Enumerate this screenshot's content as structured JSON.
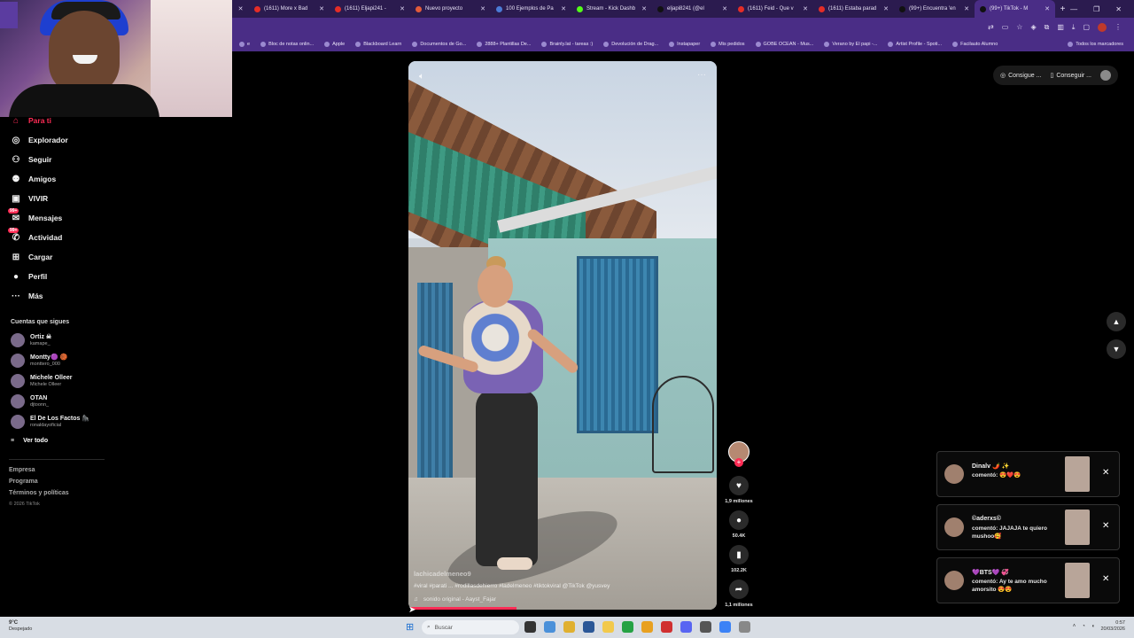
{
  "browser": {
    "tabs": [
      {
        "title": "(1611) More x Bad",
        "color": "#e52d27"
      },
      {
        "title": "(1611) Eljapi241 -",
        "color": "#e52d27"
      },
      {
        "title": "Nuevo proyecto",
        "color": "#e25b3a"
      },
      {
        "title": "100 Ejemplos de Pa",
        "color": "#4b7bd6"
      },
      {
        "title": "Stream - Kick Dashb",
        "color": "#53fc18"
      },
      {
        "title": "eljapi8241 (@el",
        "color": "#111111"
      },
      {
        "title": "(1611) Feid - Que v",
        "color": "#e52d27"
      },
      {
        "title": "(1611) Estaba parad",
        "color": "#e52d27"
      },
      {
        "title": "(99+) Encuentra 'en",
        "color": "#111111"
      },
      {
        "title": "(99+) TikTok - M",
        "color": "#111111"
      }
    ],
    "bookmarks": [
      "e",
      "Bloc de notas onlin...",
      "Apple",
      "Blackboard Learn",
      "Documentos de Go...",
      "2888+ Plantillas De...",
      "Brainly.lat - tareas :)",
      "Devolución de Drag...",
      "Instapaper",
      "Mis pedidos",
      "GOBE OCEAN - Mus...",
      "Verano by El papi -...",
      "Artist Profile - Spoti...",
      "Facilauto Alumno"
    ],
    "all_bookmarks": "Todos los marcadores"
  },
  "sidebar": {
    "nav": [
      {
        "label": "Para ti",
        "icon": "home-icon",
        "glyph": "⌂",
        "active": true,
        "badge": ""
      },
      {
        "label": "Explorador",
        "icon": "compass-icon",
        "glyph": "◎",
        "active": false,
        "badge": ""
      },
      {
        "label": "Seguir",
        "icon": "follow-icon",
        "glyph": "⚇",
        "active": false,
        "badge": ""
      },
      {
        "label": "Amigos",
        "icon": "friends-icon",
        "glyph": "⚉",
        "active": false,
        "badge": ""
      },
      {
        "label": "VIVIR",
        "icon": "live-icon",
        "glyph": "▣",
        "active": false,
        "badge": ""
      },
      {
        "label": "Mensajes",
        "icon": "messages-icon",
        "glyph": "✉",
        "active": false,
        "badge": "99+"
      },
      {
        "label": "Actividad",
        "icon": "activity-icon",
        "glyph": "✆",
        "active": false,
        "badge": "99+"
      },
      {
        "label": "Cargar",
        "icon": "upload-icon",
        "glyph": "⊞",
        "active": false,
        "badge": ""
      },
      {
        "label": "Perfil",
        "icon": "profile-icon",
        "glyph": "●",
        "active": false,
        "badge": ""
      },
      {
        "label": "Más",
        "icon": "more-icon",
        "glyph": "···",
        "active": false,
        "badge": ""
      }
    ],
    "following_title": "Cuentas que sigues",
    "following": [
      {
        "name": "Ortiz ☠",
        "handle": "kamape_"
      },
      {
        "name": "Montty🟣 🏀",
        "handle": "monttero_000"
      },
      {
        "name": "Michele Olleer",
        "handle": "Michele Olleer"
      },
      {
        "name": "OTAN",
        "handle": "djtoonn_"
      },
      {
        "name": "El De Los Factos 🦍",
        "handle": "ronaldayoficial"
      }
    ],
    "see_all": "Ver todo",
    "footer": [
      "Empresa",
      "Programa",
      "Términos y políticas"
    ],
    "copyright": "© 2026 TikTok"
  },
  "video": {
    "username": "lachicadelmeneo9",
    "hashtags": "#viral #parati ... #rodillasdehierro #ladelmeneo #tiktokviral @TikTok @yusvey",
    "sound": "sonido original - Aayst_Fajar",
    "progress": 0.35
  },
  "actions": {
    "likes": "1,9 millones",
    "comments": "50.4K",
    "saves": "102.2K",
    "shares": "1,1 millones"
  },
  "top_buttons": [
    "Consigue ...",
    "Conseguir ..."
  ],
  "notifications": [
    {
      "name": "Dinalv 🌶️ ✨",
      "text": "comentó: 😍❤️😍"
    },
    {
      "name": "©aderxs©",
      "text": "comentó: JAJAJA te quiero mushoo🥰"
    },
    {
      "name": "💜BTS💜 💞",
      "text": "comentó: Ay te amo mucho amorsito 😍😍"
    }
  ],
  "taskbar": {
    "weather_temp": "9°C",
    "weather_text": "Despejado",
    "search_placeholder": "Buscar",
    "time": "0:57",
    "date": "20/03/2026"
  }
}
